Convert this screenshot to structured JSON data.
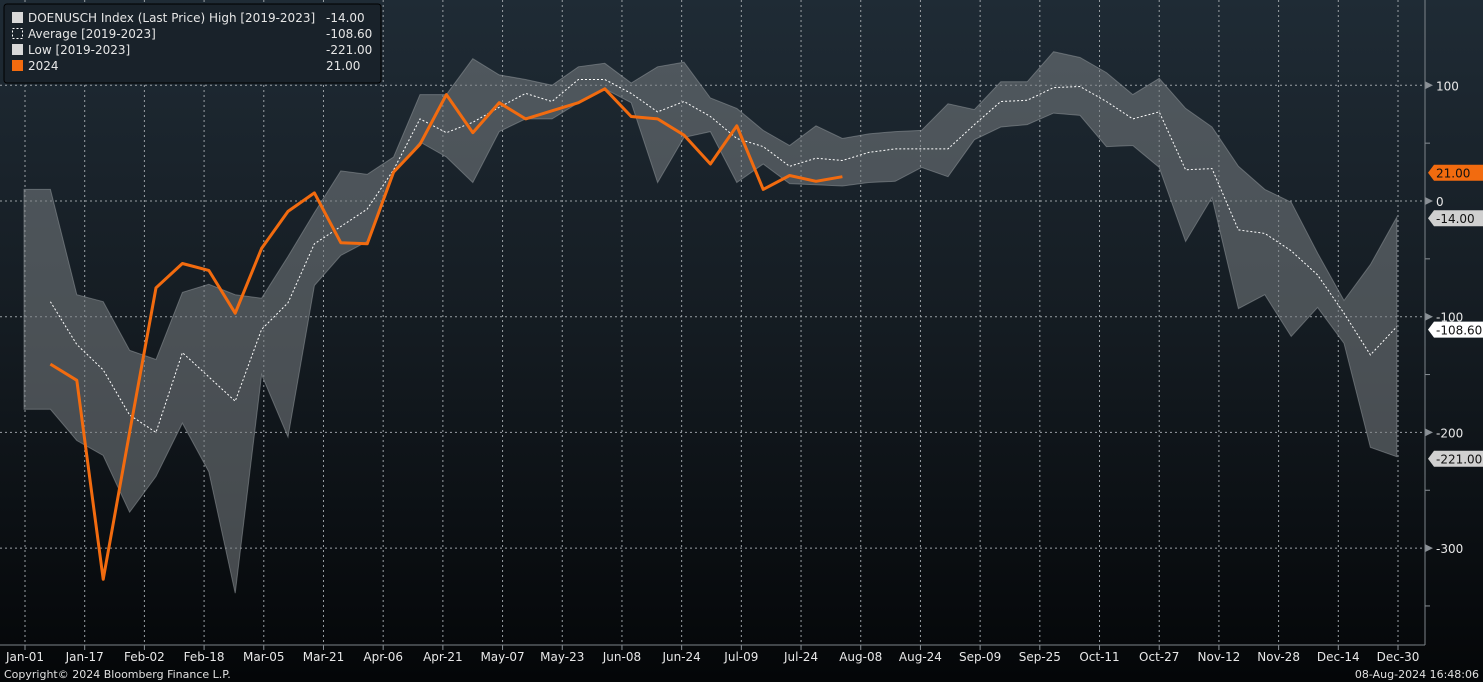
{
  "chart_data": {
    "type": "area",
    "title": "",
    "xlabel": "",
    "ylabel": "",
    "x_tick_labels": [
      "Jan-01",
      "Jan-17",
      "Feb-02",
      "Feb-18",
      "Mar-05",
      "Mar-21",
      "Apr-06",
      "Apr-21",
      "May-07",
      "May-23",
      "Jun-08",
      "Jun-24",
      "Jul-09",
      "Jul-24",
      "Aug-08",
      "Aug-24",
      "Sep-09",
      "Sep-25",
      "Oct-11",
      "Oct-27",
      "Nov-12",
      "Nov-28",
      "Dec-14",
      "Dec-30"
    ],
    "y_ticks": [
      100,
      0,
      -100,
      -200,
      -300
    ],
    "ylim": [
      -384,
      174
    ],
    "grid": true,
    "legend_position": "top-left",
    "x_unit": "week of year (0-52)",
    "series": [
      {
        "name": "DOENUSCH Index (Last Price) High [2019-2023]",
        "last_value": "-14.00",
        "color": "#d9d9d9",
        "values": [
          10,
          10,
          -81,
          -87,
          -129,
          -137,
          -79,
          -72,
          -81,
          -84,
          -48,
          -10,
          26,
          23,
          38,
          92,
          92,
          123,
          109,
          105,
          100,
          116,
          119,
          102,
          116,
          120,
          89,
          80,
          61,
          48,
          65,
          54,
          58,
          60,
          61,
          84,
          79,
          103,
          103,
          129,
          124,
          111,
          92,
          106,
          80,
          64,
          30,
          10,
          -1,
          -45,
          -86,
          -55,
          -14
        ]
      },
      {
        "name": "Average  [2019-2023]",
        "last_value": "-108.60",
        "color": "#ffffff",
        "values": [
          null,
          -87,
          -124,
          -146,
          -185,
          -200,
          -131,
          -152,
          -173,
          -111,
          -88,
          -37,
          -22,
          -7,
          27,
          71,
          59,
          68,
          81,
          93,
          86,
          105,
          105,
          93,
          77,
          86,
          73,
          54,
          47,
          30,
          37,
          35,
          42,
          45,
          45,
          45,
          66,
          86,
          87,
          98,
          99,
          86,
          71,
          77,
          27,
          28,
          -25,
          -28,
          -43,
          -64,
          -97,
          -133,
          -108.6
        ]
      },
      {
        "name": "Low  [2019-2023]",
        "last_value": "-221.00",
        "color": "#d9d9d9",
        "values": [
          -180,
          -180,
          -207,
          -220,
          -269,
          -238,
          -192,
          -234,
          -339,
          -150,
          -204,
          -73,
          -47,
          -35,
          24,
          51,
          38,
          16,
          60,
          71,
          71,
          85,
          97,
          85,
          16,
          55,
          60,
          16,
          32,
          15,
          14,
          13,
          16,
          17,
          29,
          21,
          53,
          64,
          66,
          76,
          74,
          47,
          48,
          29,
          -35,
          3,
          -93,
          -81,
          -117,
          -92,
          -123,
          -213,
          -221
        ]
      },
      {
        "name": "2024",
        "last_value": "21.00",
        "color": "#f26b0f",
        "values": [
          null,
          -141,
          -155,
          -327,
          -200,
          -75,
          -54,
          -60,
          -97,
          -41,
          -9,
          7,
          -36,
          -37,
          25,
          49,
          92,
          59,
          85,
          71,
          78,
          85,
          97,
          73,
          71,
          57,
          32,
          65,
          10,
          22,
          17,
          21
        ]
      }
    ]
  },
  "footer": {
    "copyright": "Copyright© 2024 Bloomberg Finance L.P.",
    "timestamp": "08-Aug-2024 16:48:06"
  }
}
